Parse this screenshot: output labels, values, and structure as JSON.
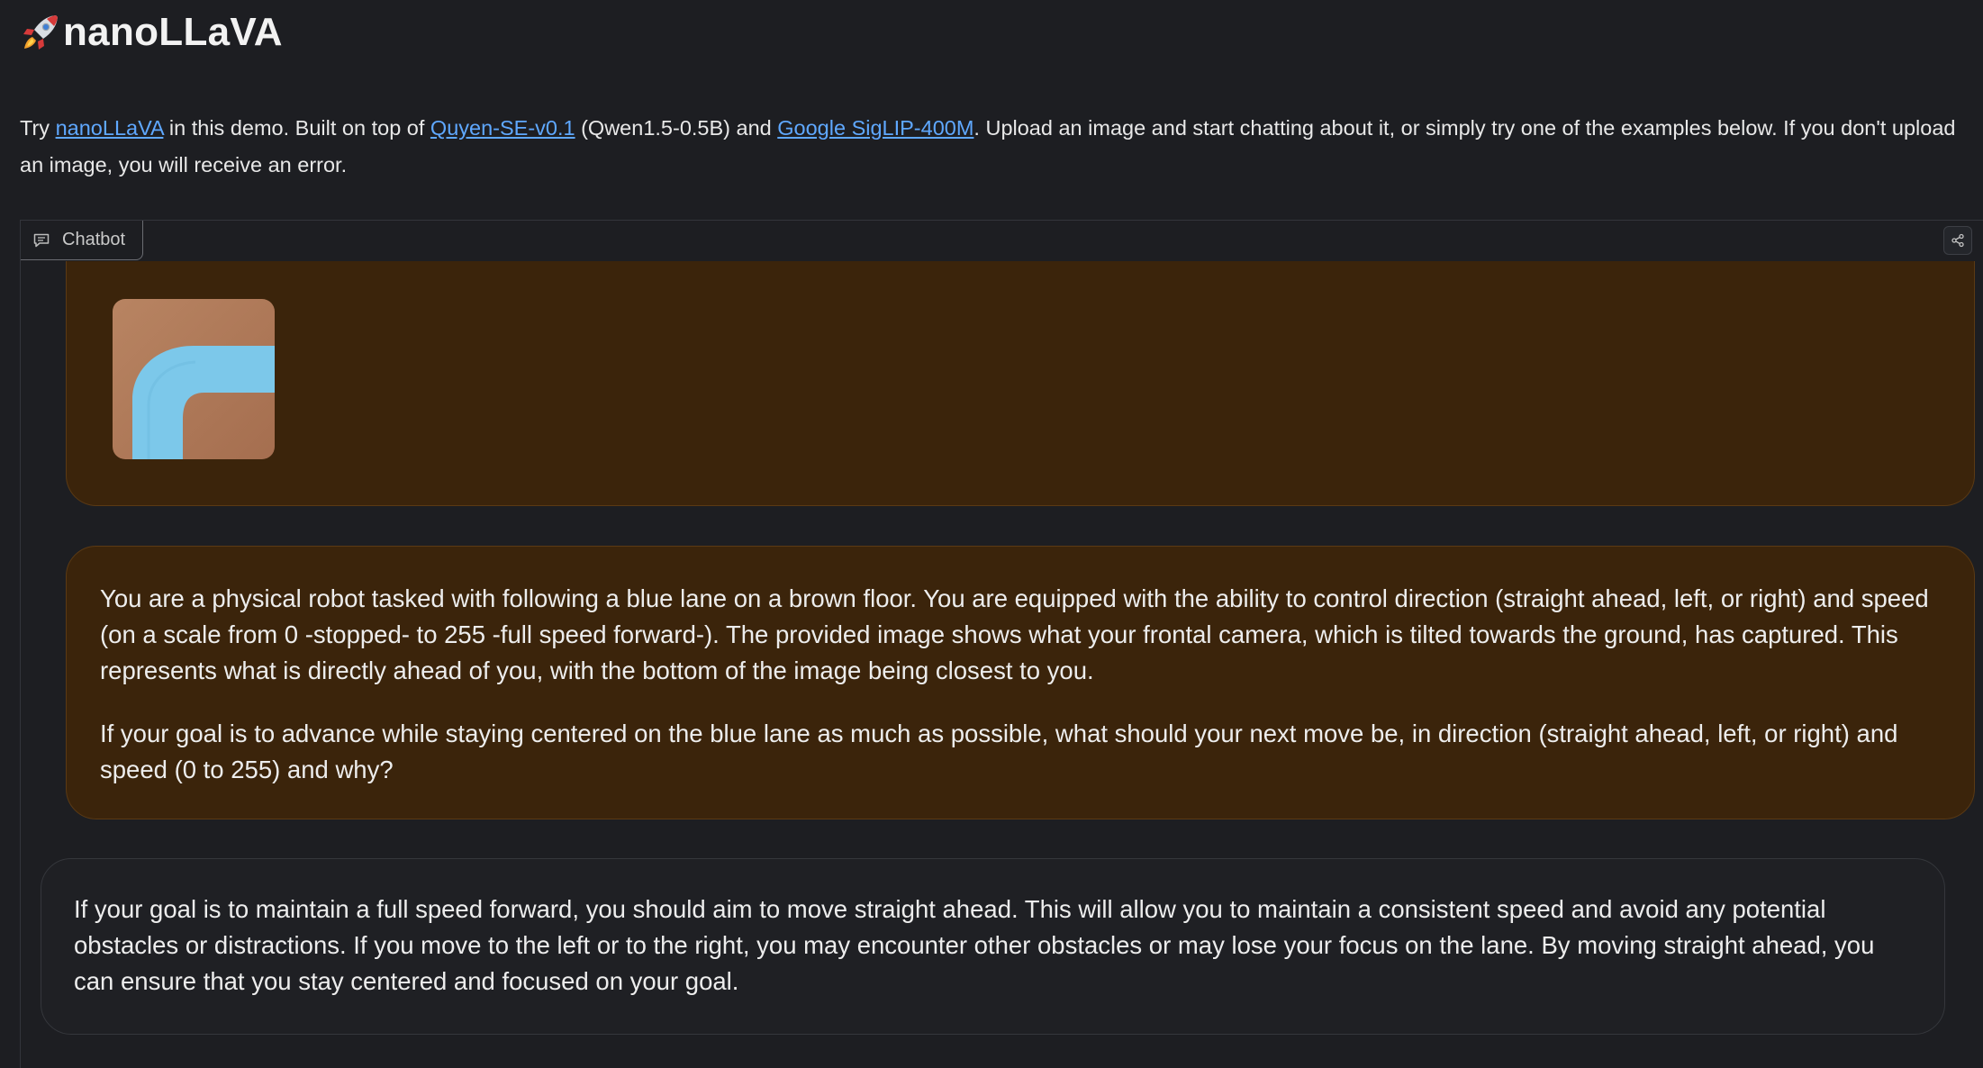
{
  "app": {
    "title": "nanoLLaVA"
  },
  "description": {
    "try": "Try ",
    "link1": "nanoLLaVA",
    "part2": " in this demo. Built on top of ",
    "link2": "Quyen-SE-v0.1",
    "part3": " (Qwen1.5-0.5B) and ",
    "link3": "Google SigLIP-400M",
    "part4": ". Upload an image and start chatting about it, or simply try one of the examples below. If you don't upload an image, you will receive an error."
  },
  "chatbot": {
    "label": "Chatbot",
    "messages": {
      "user_text_p1": "You are a physical robot tasked with following a blue lane on a brown floor. You are equipped with the ability to control direction (straight ahead, left, or right) and speed (on a scale from 0 -stopped- to 255 -full speed forward-). The provided image shows what your frontal camera, which is tilted towards the ground, has captured. This represents what is directly ahead of you, with the bottom of the image being closest to you.",
      "user_text_p2": "If your goal is to advance while staying centered on the blue lane as much as possible, what should your next move be, in direction (straight ahead, left, or right) and speed (0 to 255) and why?",
      "bot_text": "If your goal is to maintain a full speed forward, you should aim to move straight ahead. This will allow you to maintain a consistent speed and avoid any potential obstacles or distractions. If you move to the left or to the right, you may encounter other obstacles or may lose your focus on the lane. By moving straight ahead, you can ensure that you stay centered and focused on your goal."
    }
  },
  "icons": {
    "title": "rocket-icon",
    "tab": "chat-icon",
    "share": "share-icon"
  },
  "colors": {
    "background": "#1d1e22",
    "link": "#5fa8ff",
    "user_bubble": "#3b240b",
    "bot_bubble": "#1f2024",
    "lane_blue": "#7cc7e8",
    "floor_brown": "#b07a58"
  }
}
